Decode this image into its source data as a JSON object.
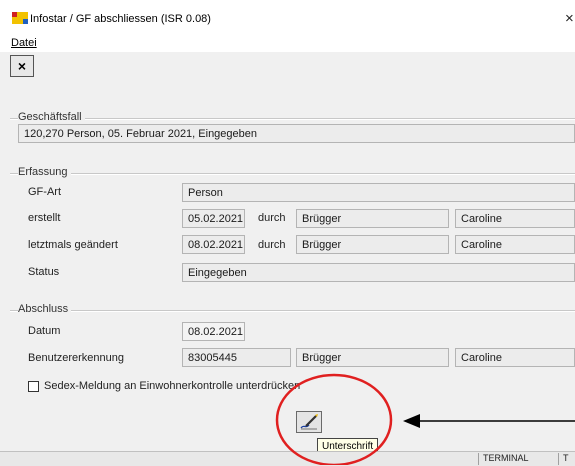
{
  "window": {
    "title": "Infostar / GF abschliessen (ISR 0.08)",
    "close_glyph": "×"
  },
  "menu": {
    "items": [
      {
        "label": "Datei"
      }
    ]
  },
  "toolbar": {
    "close_button_glyph": "×"
  },
  "geschaeftsfall": {
    "section_label": "Geschäftsfall",
    "value": "120,270  Person, 05. Februar 2021, Eingegeben"
  },
  "erfassung": {
    "section_label": "Erfassung",
    "gf_art": {
      "label": "GF-Art",
      "value": "Person"
    },
    "erstellt": {
      "label": "erstellt",
      "date": "05.02.2021",
      "durch": "durch",
      "name": "Brügger",
      "vorname": "Caroline"
    },
    "geaendert": {
      "label": "letztmals geändert",
      "date": "08.02.2021",
      "durch": "durch",
      "name": "Brügger",
      "vorname": "Caroline"
    },
    "status": {
      "label": "Status",
      "value": "Eingegeben"
    }
  },
  "abschluss": {
    "section_label": "Abschluss",
    "datum": {
      "label": "Datum",
      "value": "08.02.2021"
    },
    "benutzer": {
      "label": "Benutzererkennung",
      "id": "83005445",
      "name": "Brügger",
      "vorname": "Caroline"
    },
    "sedex_checkbox": {
      "label": "Sedex-Meldung an Einwohnerkontrolle unterdrücken",
      "checked": false
    }
  },
  "signature_button": {
    "icon": "signature-pen-icon",
    "tooltip": "Unterschrift"
  },
  "statusbar": {
    "cells": [
      "TERMINAL",
      "T"
    ]
  },
  "annotation": {
    "circle_color": "#e02020",
    "arrow_color": "#000000"
  },
  "colors": {
    "background": "#f0f0f0",
    "field": "#ececec",
    "accent_icon": "#e8b400"
  }
}
